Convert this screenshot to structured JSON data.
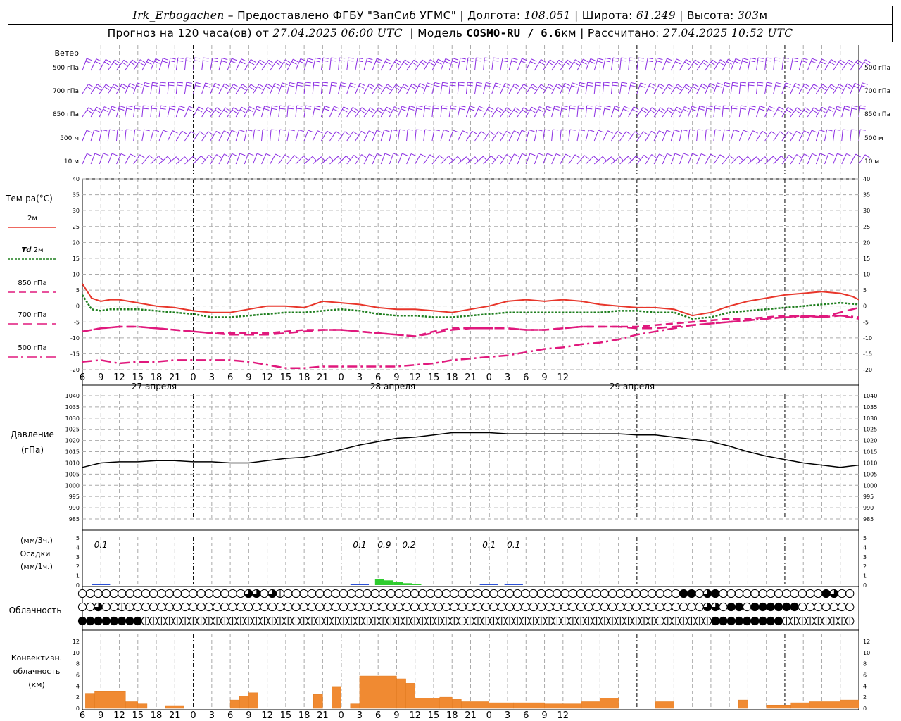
{
  "header": {
    "station": "Irk_Erbogachen",
    "provider": " – Предоставлено ФГБУ \"ЗапСиб УГМС\" | Долгота: ",
    "lon": "108.051",
    "lat_label": " | Широта: ",
    "lat": "61.249",
    "alt_label": " | Высота: ",
    "alt": "303",
    "alt_unit": "м",
    "forecast_label": "Прогноз на 120 часа(ов) от ",
    "run_time": "27.04.2025 06:00 UTC",
    "model_label": "  | Модель ",
    "model": "COSMO-RU / 6.6",
    "model_unit": "км",
    "calc_label": " | Рассчитано: ",
    "calc_time": "27.04.2025 10:52 UTC"
  },
  "colors": {
    "wind": "#8a2be2",
    "t2m": "#e8362b",
    "td2m": "#1f7f1f",
    "t850": "#e0197d",
    "t700": "#e0197d",
    "t500": "#e0197d",
    "pressure": "#000000",
    "precip_light": "#2a4fd6",
    "precip_moderate": "#2ecc2e",
    "convective": "#f08a32"
  },
  "panels": {
    "wind": {
      "title": "Ветер",
      "levels": [
        "500 гПа",
        "700 гПа",
        "850 гПа",
        "500 м",
        "10 м"
      ]
    },
    "temp": {
      "title": "Тем-ра(°C)",
      "legend": [
        {
          "key": "t2m",
          "label": "2м"
        },
        {
          "key": "td2m",
          "label_it": "Td",
          "label": " 2м"
        },
        {
          "key": "t850",
          "label": "850 гПа"
        },
        {
          "key": "t700",
          "label": "700 гПа"
        },
        {
          "key": "t500",
          "label": "500 гПа"
        }
      ],
      "yticks": [
        "40",
        "35",
        "30",
        "25",
        "20",
        "15",
        "10",
        "5",
        "0",
        "-5",
        "-10",
        "-15",
        "-20"
      ]
    },
    "pressure": {
      "title1": "Давление",
      "title2": "(гПа)",
      "yticks": [
        "1040",
        "1035",
        "1030",
        "1025",
        "1020",
        "1015",
        "1010",
        "1005",
        "1000",
        "995",
        "990",
        "985"
      ]
    },
    "precip": {
      "unit1": "(мм/3ч.)",
      "title": "Осадки",
      "unit2": "(мм/1ч.)",
      "yticks": [
        "5",
        "4",
        "3",
        "2",
        "1",
        "0"
      ]
    },
    "cloud": {
      "title": "Облачность"
    },
    "conv": {
      "title1": "Конвективн.",
      "title2": "облачность",
      "title3": "(км)",
      "yticks": [
        "12",
        "10",
        "8",
        "6",
        "4",
        "2",
        "0"
      ]
    }
  },
  "time_axis": {
    "hour_labels": [
      "6",
      "9",
      "12",
      "15",
      "18",
      "21",
      "0",
      "3",
      "6",
      "9",
      "12",
      "15",
      "18",
      "21",
      "0",
      "3",
      "6",
      "9",
      "12",
      "15",
      "18",
      "21",
      "0",
      "3",
      "6",
      "9",
      "12"
    ],
    "day_labels": [
      "27 апреля",
      "28 апреля",
      "29 апреля"
    ]
  },
  "chart_data": {
    "type": "line",
    "x_unit": "hours since 27.04.2025 06:00 UTC",
    "x_range": [
      0,
      126
    ],
    "temperature": {
      "ylim": [
        -20,
        40
      ],
      "series": [
        {
          "key": "t2m",
          "name": "2м",
          "style": "solid",
          "x": [
            0,
            1.5,
            3,
            4.5,
            6,
            9,
            12,
            15,
            18,
            21,
            24,
            27,
            30,
            33,
            36,
            39,
            42,
            45,
            48,
            51,
            54,
            57,
            60,
            63,
            66,
            69,
            72,
            75,
            78,
            81,
            84,
            87,
            90,
            93,
            96,
            99,
            102,
            105,
            108,
            111,
            114,
            117,
            120,
            123,
            125,
            126
          ],
          "y": [
            7,
            2.5,
            1.5,
            2,
            2,
            1,
            0,
            -0.5,
            -1.5,
            -2,
            -2,
            -1,
            0,
            0,
            -0.5,
            1.5,
            1,
            0.5,
            -0.5,
            -1,
            -1,
            -1.5,
            -2,
            -1,
            0,
            1.5,
            2,
            1.5,
            2,
            1.5,
            0.5,
            0,
            -0.5,
            -0.5,
            -1,
            -3,
            -2,
            0,
            1.5,
            2.5,
            3.5,
            4,
            4.5,
            4,
            3,
            2
          ]
        },
        {
          "key": "td2m",
          "name": "Td 2м",
          "style": "dotted",
          "x": [
            0,
            1.5,
            3,
            4.5,
            6,
            9,
            12,
            15,
            18,
            21,
            24,
            27,
            30,
            33,
            36,
            39,
            42,
            45,
            48,
            51,
            54,
            57,
            60,
            63,
            66,
            69,
            72,
            75,
            78,
            81,
            84,
            87,
            90,
            93,
            96,
            99,
            102,
            105,
            108,
            111,
            114,
            117,
            120,
            123,
            126
          ],
          "y": [
            3.5,
            -1,
            -1.5,
            -1,
            -1,
            -1,
            -1.5,
            -2,
            -2.5,
            -3.5,
            -3.5,
            -3,
            -2.5,
            -2,
            -2,
            -1.5,
            -1,
            -1.5,
            -2.5,
            -3,
            -3,
            -3.5,
            -3.5,
            -3,
            -2.5,
            -2,
            -2,
            -2,
            -2,
            -2,
            -2,
            -1.5,
            -1.5,
            -2,
            -2,
            -4,
            -3.5,
            -2,
            -1.5,
            -1,
            -0.5,
            0,
            0.5,
            1,
            0.5
          ]
        },
        {
          "key": "t850",
          "name": "850 гПа",
          "style": "dash-small",
          "x": [
            0,
            3,
            6,
            9,
            12,
            15,
            18,
            21,
            24,
            27,
            30,
            33,
            36,
            39,
            42,
            45,
            48,
            51,
            54,
            57,
            60,
            63,
            66,
            69,
            72,
            75,
            78,
            81,
            84,
            87,
            90,
            93,
            96,
            99,
            102,
            105,
            108,
            111,
            114,
            117,
            120,
            123,
            126
          ],
          "y": [
            -8,
            -7,
            -6.5,
            -6.5,
            -7,
            -7.5,
            -8,
            -8.5,
            -8.5,
            -8.5,
            -8.5,
            -8,
            -7.5,
            -7.5,
            -7.5,
            -8,
            -8.5,
            -9,
            -9.5,
            -8,
            -7,
            -7,
            -7,
            -7,
            -7.5,
            -7.5,
            -7,
            -6.5,
            -6.5,
            -6.5,
            -6.5,
            -6,
            -5.5,
            -5,
            -4.5,
            -4,
            -4,
            -3.5,
            -3,
            -3,
            -3.5,
            -3,
            -4
          ]
        },
        {
          "key": "t700",
          "name": "700 гПа",
          "style": "dash-large",
          "x": [
            0,
            3,
            6,
            9,
            12,
            15,
            18,
            21,
            24,
            27,
            30,
            33,
            36,
            39,
            42,
            45,
            48,
            51,
            54,
            57,
            60,
            63,
            66,
            69,
            72,
            75,
            78,
            81,
            84,
            87,
            90,
            93,
            96,
            99,
            102,
            105,
            108,
            111,
            114,
            117,
            120,
            123,
            126
          ],
          "y": [
            -8,
            -7,
            -6.5,
            -6.5,
            -7,
            -7.5,
            -8,
            -8.5,
            -9,
            -9,
            -9,
            -8.5,
            -8,
            -7.5,
            -7.5,
            -8,
            -8.5,
            -9,
            -9.5,
            -8.5,
            -7.5,
            -7,
            -7,
            -7,
            -7.5,
            -7.5,
            -7,
            -6.5,
            -6.5,
            -6.5,
            -7,
            -7,
            -6.5,
            -6,
            -5.5,
            -5,
            -4.5,
            -4,
            -3.5,
            -3,
            -3.5,
            -2,
            -0.5
          ]
        },
        {
          "key": "t500",
          "name": "500 гПа",
          "style": "dash-dot",
          "x": [
            0,
            3,
            6,
            9,
            12,
            15,
            18,
            21,
            24,
            27,
            30,
            33,
            36,
            39,
            42,
            45,
            48,
            51,
            54,
            57,
            60,
            63,
            66,
            69,
            72,
            75,
            78,
            81,
            84,
            87,
            90,
            93,
            96,
            99,
            102,
            105,
            108,
            111,
            114,
            117,
            120,
            123,
            126
          ],
          "y": [
            -17.5,
            -17,
            -18,
            -17.5,
            -17.5,
            -17,
            -17,
            -17,
            -17,
            -17.5,
            -18.5,
            -19.5,
            -19.5,
            -19,
            -19,
            -19,
            -19,
            -19,
            -18.5,
            -18,
            -17,
            -16.5,
            -16,
            -15.5,
            -14.5,
            -13.5,
            -13,
            -12,
            -11.5,
            -10.5,
            -9,
            -8,
            -7,
            -6,
            -5.5,
            -5,
            -4.5,
            -4,
            -3.5,
            -3.5,
            -3,
            -3,
            -3.5
          ]
        }
      ]
    },
    "pressure": {
      "ylim": [
        985,
        1040
      ],
      "name": "Давление",
      "x": [
        0,
        3,
        6,
        9,
        12,
        15,
        18,
        21,
        24,
        27,
        30,
        33,
        36,
        39,
        42,
        45,
        48,
        51,
        54,
        57,
        60,
        63,
        66,
        69,
        72,
        75,
        78,
        81,
        84,
        87,
        90,
        93,
        96,
        99,
        102,
        105,
        108,
        111,
        114,
        117,
        120,
        123,
        126
      ],
      "y": [
        1008,
        1010,
        1010.5,
        1010.5,
        1011,
        1011,
        1010.5,
        1010.5,
        1010,
        1010,
        1011,
        1012,
        1012.5,
        1014,
        1016,
        1018,
        1019.5,
        1021,
        1021.5,
        1022.5,
        1023.5,
        1023.5,
        1023.5,
        1023,
        1023,
        1023,
        1023,
        1023,
        1023,
        1023,
        1022.5,
        1022.5,
        1021.5,
        1020.5,
        1019.5,
        1017.5,
        1015,
        1013,
        1011.5,
        1010,
        1009,
        1008,
        1009
      ]
    },
    "precip": {
      "ylim": [
        0,
        5
      ],
      "labels": [
        {
          "x": 3,
          "text": "0.1"
        },
        {
          "x": 45,
          "text": "0.1"
        },
        {
          "x": 49,
          "text": "0.9"
        },
        {
          "x": 53,
          "text": "0.2"
        },
        {
          "x": 66,
          "text": "0.1"
        },
        {
          "x": 70,
          "text": "0.1"
        }
      ],
      "bars": [
        {
          "x0": 1.5,
          "x1": 4.5,
          "v": 0.15,
          "kind": "light"
        },
        {
          "x0": 43.5,
          "x1": 46.5,
          "v": 0.1,
          "kind": "light"
        },
        {
          "x0": 47.5,
          "x1": 49,
          "v": 0.6,
          "kind": "moderate"
        },
        {
          "x0": 49,
          "x1": 50.5,
          "v": 0.5,
          "kind": "moderate"
        },
        {
          "x0": 50.5,
          "x1": 52,
          "v": 0.35,
          "kind": "moderate"
        },
        {
          "x0": 52,
          "x1": 53.5,
          "v": 0.2,
          "kind": "moderate"
        },
        {
          "x0": 53.5,
          "x1": 55,
          "v": 0.1,
          "kind": "moderate"
        },
        {
          "x0": 64.5,
          "x1": 67.5,
          "v": 0.1,
          "kind": "light"
        },
        {
          "x0": 68.5,
          "x1": 71.5,
          "v": 0.1,
          "kind": "light"
        }
      ]
    },
    "clouds": {
      "x0": 0,
      "step": 1.5,
      "high": "00000000000000000000066063000000000000000000000000000000000000000000000000008806800000000000008600008080080000000000000000000000000000000000000000000000000000000600600000000000008588",
      "mid": "00600330000000000000000000000000000000000000000000000000000000000000000000000006608808888880000000000000000000000003000000000000000000000000000000006000000000000000000000000000000000",
      "low": "88888888333333333333333333333333333333333333333333333333333333333333333333333333888888888333333333333333333333333333333333333333333333333333333333333333333333333333333333333333333333333"
    },
    "conv": {
      "ylim": [
        0,
        13
      ],
      "bars": [
        {
          "x0": 0.5,
          "x1": 2,
          "top": 2.7
        },
        {
          "x0": 2,
          "x1": 7,
          "top": 3
        },
        {
          "x0": 7,
          "x1": 9,
          "top": 1.2
        },
        {
          "x0": 9,
          "x1": 10.5,
          "top": 0.8
        },
        {
          "x0": 13.5,
          "x1": 16.5,
          "top": 0.5
        },
        {
          "x0": 24,
          "x1": 25.5,
          "top": 1.5
        },
        {
          "x0": 25.5,
          "x1": 27,
          "top": 2.2
        },
        {
          "x0": 27,
          "x1": 28.5,
          "top": 2.8
        },
        {
          "x0": 37.5,
          "x1": 39,
          "top": 2.5
        },
        {
          "x0": 40.5,
          "x1": 42,
          "top": 3.8
        },
        {
          "x0": 43.5,
          "x1": 45,
          "top": 0.8
        },
        {
          "x0": 45,
          "x1": 51,
          "top": 5.8
        },
        {
          "x0": 51,
          "x1": 52.5,
          "top": 5.3
        },
        {
          "x0": 52.5,
          "x1": 54,
          "top": 4.5
        },
        {
          "x0": 54,
          "x1": 58,
          "top": 1.8
        },
        {
          "x0": 58,
          "x1": 60,
          "top": 2
        },
        {
          "x0": 60,
          "x1": 61.5,
          "top": 1.6
        },
        {
          "x0": 61.5,
          "x1": 66,
          "top": 1.2
        },
        {
          "x0": 66,
          "x1": 70,
          "top": 1
        },
        {
          "x0": 70,
          "x1": 75,
          "top": 1
        },
        {
          "x0": 75,
          "x1": 81,
          "top": 0.8
        },
        {
          "x0": 81,
          "x1": 84,
          "top": 1.2
        },
        {
          "x0": 84,
          "x1": 87,
          "top": 1.8
        },
        {
          "x0": 93,
          "x1": 96,
          "top": 1.2
        },
        {
          "x0": 106.5,
          "x1": 108,
          "top": 1.5
        },
        {
          "x0": 111,
          "x1": 115,
          "top": 0.6
        },
        {
          "x0": 115,
          "x1": 118,
          "top": 1
        },
        {
          "x0": 118,
          "x1": 123,
          "top": 1.2
        },
        {
          "x0": 123,
          "x1": 127,
          "top": 1.5
        },
        {
          "x0": 127,
          "x1": 131,
          "top": 1.3
        },
        {
          "x0": 131,
          "x1": 134,
          "top": 1.6
        }
      ]
    }
  }
}
